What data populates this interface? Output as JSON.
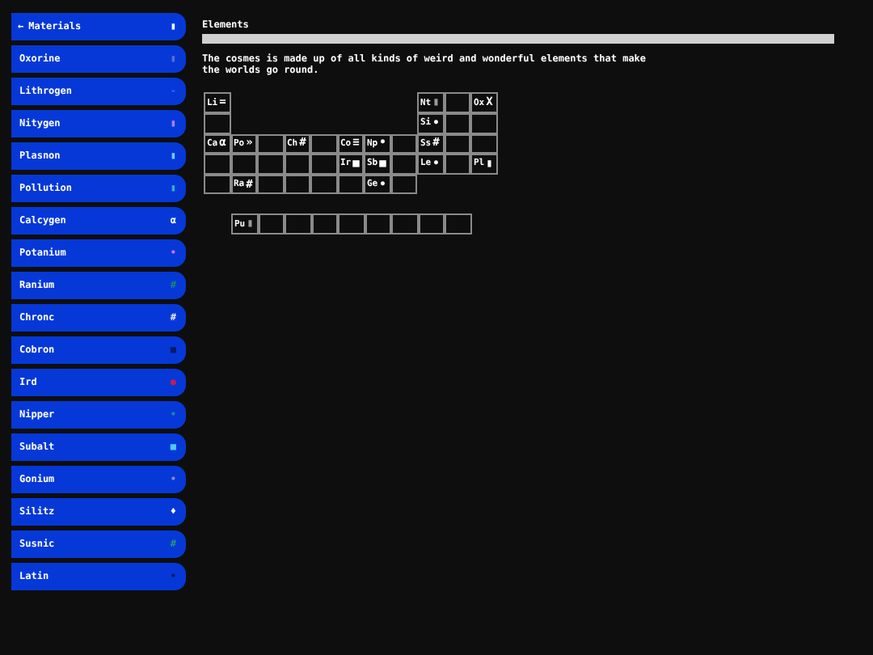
{
  "sidebar": {
    "header": {
      "arrow": "←",
      "label": "Materials",
      "glyph": "▮",
      "color": "#ffffff"
    },
    "items": [
      {
        "label": "Oxorine",
        "glyph": "▮",
        "color": "#5a6fc8"
      },
      {
        "label": "Lithrogen",
        "glyph": "-",
        "color": "#3a6ee0"
      },
      {
        "label": "Nitygen",
        "glyph": "▮",
        "color": "#b080ff"
      },
      {
        "label": "Plasnon",
        "glyph": "▮",
        "color": "#6fd0ff"
      },
      {
        "label": "Pollution",
        "glyph": "▮",
        "color": "#30b0c8"
      },
      {
        "label": "Calcygen",
        "glyph": "α",
        "color": "#ffffff"
      },
      {
        "label": "Potanium",
        "glyph": "•",
        "color": "#d070ff"
      },
      {
        "label": "Ranium",
        "glyph": "#",
        "color": "#1a8a6a"
      },
      {
        "label": "Chronc",
        "glyph": "#",
        "color": "#e8e8ff"
      },
      {
        "label": "Cobron",
        "glyph": "■",
        "color": "#0a1a6a"
      },
      {
        "label": "Ird",
        "glyph": "●",
        "color": "#c0204a"
      },
      {
        "label": "Nipper",
        "glyph": "•",
        "color": "#1a8aa0"
      },
      {
        "label": "Subalt",
        "glyph": "■",
        "color": "#50c8ff"
      },
      {
        "label": "Gonium",
        "glyph": "•",
        "color": "#8a8ac8"
      },
      {
        "label": "Silitz",
        "glyph": "♦",
        "color": "#ffffff"
      },
      {
        "label": "Susnic",
        "glyph": "#",
        "color": "#2a9a6a"
      },
      {
        "label": "Latin",
        "glyph": "•",
        "color": "#0a1a5a"
      }
    ]
  },
  "main": {
    "title": "Elements",
    "description": "The cosmes is made up of all kinds of weird and wonderful elements that make the worlds go round.",
    "table": {
      "rows": [
        [
          {
            "kind": "element",
            "symbol": "Li",
            "glyph": "=",
            "color": "#ffffff"
          },
          {
            "kind": "gap"
          },
          {
            "kind": "gap"
          },
          {
            "kind": "gap"
          },
          {
            "kind": "gap"
          },
          {
            "kind": "gap"
          },
          {
            "kind": "gap"
          },
          {
            "kind": "gap"
          },
          {
            "kind": "element",
            "symbol": "Nt",
            "glyph": "▮",
            "color": "#9a9a9a"
          },
          {
            "kind": "empty"
          },
          {
            "kind": "element",
            "symbol": "Ox",
            "glyph": "X",
            "color": "#ffffff"
          }
        ],
        [
          {
            "kind": "empty"
          },
          {
            "kind": "gap"
          },
          {
            "kind": "gap"
          },
          {
            "kind": "gap"
          },
          {
            "kind": "gap"
          },
          {
            "kind": "gap"
          },
          {
            "kind": "gap"
          },
          {
            "kind": "gap"
          },
          {
            "kind": "element",
            "symbol": "Si",
            "glyph": "•",
            "color": "#ffffff"
          },
          {
            "kind": "empty"
          },
          {
            "kind": "empty"
          }
        ],
        [
          {
            "kind": "element",
            "symbol": "Ca",
            "glyph": "α",
            "color": "#ffffff"
          },
          {
            "kind": "element",
            "symbol": "Po",
            "glyph": "»",
            "color": "#ffffff"
          },
          {
            "kind": "empty"
          },
          {
            "kind": "element",
            "symbol": "Ch",
            "glyph": "#",
            "color": "#ffffff"
          },
          {
            "kind": "empty"
          },
          {
            "kind": "element",
            "symbol": "Co",
            "glyph": "≡",
            "color": "#ffffff"
          },
          {
            "kind": "element",
            "symbol": "Np",
            "glyph": "•",
            "color": "#ffffff"
          },
          {
            "kind": "empty"
          },
          {
            "kind": "element",
            "symbol": "Ss",
            "glyph": "#",
            "color": "#ffffff"
          },
          {
            "kind": "empty"
          },
          {
            "kind": "empty"
          }
        ],
        [
          {
            "kind": "empty"
          },
          {
            "kind": "empty"
          },
          {
            "kind": "empty"
          },
          {
            "kind": "empty"
          },
          {
            "kind": "empty"
          },
          {
            "kind": "element",
            "symbol": "Ir",
            "glyph": "■",
            "color": "#ffffff"
          },
          {
            "kind": "element",
            "symbol": "Sb",
            "glyph": "■",
            "color": "#ffffff"
          },
          {
            "kind": "empty"
          },
          {
            "kind": "element",
            "symbol": "Le",
            "glyph": "•",
            "color": "#ffffff"
          },
          {
            "kind": "empty"
          },
          {
            "kind": "element",
            "symbol": "Pl",
            "glyph": "▮",
            "color": "#ffffff"
          }
        ],
        [
          {
            "kind": "empty"
          },
          {
            "kind": "element",
            "symbol": "Ra",
            "glyph": "#",
            "color": "#ffffff"
          },
          {
            "kind": "empty"
          },
          {
            "kind": "empty"
          },
          {
            "kind": "empty"
          },
          {
            "kind": "empty"
          },
          {
            "kind": "element",
            "symbol": "Ge",
            "glyph": "•",
            "color": "#ffffff"
          },
          {
            "kind": "empty"
          },
          {
            "kind": "gap"
          },
          {
            "kind": "gap"
          },
          {
            "kind": "gap"
          }
        ]
      ]
    },
    "extra_row": [
      {
        "kind": "element",
        "symbol": "Pu",
        "glyph": "▮",
        "color": "#9a9a9a"
      },
      {
        "kind": "empty"
      },
      {
        "kind": "empty"
      },
      {
        "kind": "empty"
      },
      {
        "kind": "empty"
      },
      {
        "kind": "empty"
      },
      {
        "kind": "empty"
      },
      {
        "kind": "empty"
      },
      {
        "kind": "empty"
      }
    ]
  }
}
